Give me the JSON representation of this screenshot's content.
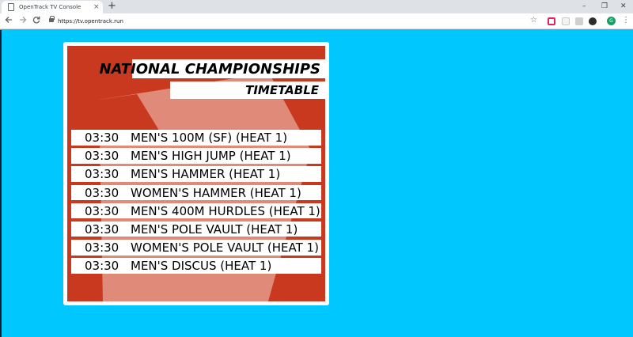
{
  "browser": {
    "tab_title": "OpenTrack TV Console",
    "tab_close": "×",
    "new_tab": "+",
    "url": "https://tv.opentrack.run",
    "avatar_letter": "G",
    "icons": [
      "back-icon",
      "forward-icon",
      "reload-icon",
      "lock-icon",
      "star-icon",
      "menu-icon"
    ],
    "window_controls": {
      "minimize": "–",
      "maximize": "❐",
      "close": "✕"
    }
  },
  "colors": {
    "page_background": "#00c8ff",
    "card_background": "#c9391f",
    "decoration": "#e08a79",
    "row_background": "#ffffff"
  },
  "timetable": {
    "title": "NATIONAL CHAMPIONSHIPS",
    "subtitle": "TIMETABLE",
    "events": [
      {
        "time": "03:30",
        "event": "MEN'S 100M (SF) (HEAT 1)"
      },
      {
        "time": "03:30",
        "event": "MEN'S HIGH JUMP (HEAT 1)"
      },
      {
        "time": "03:30",
        "event": "MEN'S HAMMER (HEAT 1)"
      },
      {
        "time": "03:30",
        "event": "WOMEN'S HAMMER (HEAT 1)"
      },
      {
        "time": "03:30",
        "event": "MEN'S 400M HURDLES (HEAT 1)"
      },
      {
        "time": "03:30",
        "event": "MEN'S POLE VAULT (HEAT 1)"
      },
      {
        "time": "03:30",
        "event": "WOMEN'S POLE VAULT (HEAT 1)"
      },
      {
        "time": "03:30",
        "event": "MEN'S DISCUS (HEAT 1)"
      }
    ]
  }
}
